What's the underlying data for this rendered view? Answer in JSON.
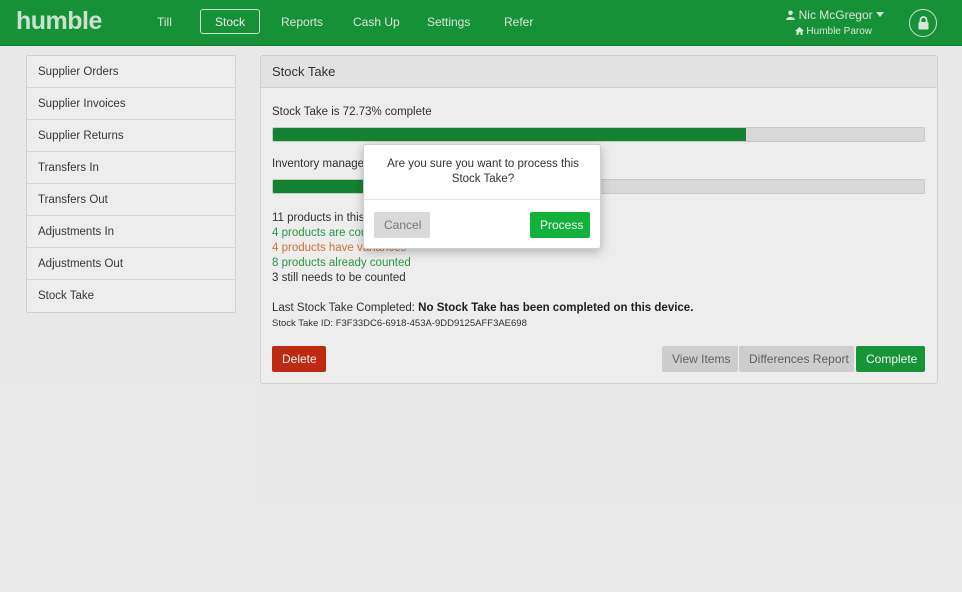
{
  "app": {
    "logo": "humble",
    "nav": [
      "Till",
      "Stock",
      "Reports",
      "Cash Up",
      "Settings",
      "Refer"
    ],
    "active_nav": "Stock",
    "user_name": "Nic McGregor",
    "store_name": "Humble Parow",
    "accent_color": "#19993a"
  },
  "sidebar": {
    "items": [
      "Supplier Orders",
      "Supplier Invoices",
      "Supplier Returns",
      "Transfers In",
      "Transfers Out",
      "Adjustments In",
      "Adjustments Out",
      "Stock Take"
    ]
  },
  "panel": {
    "title": "Stock Take",
    "progress_text": "Stock Take is 72.73% complete",
    "progress_value": 72.73,
    "inventory_label": "Inventory manager",
    "inventory_progress_value": 14,
    "stats": {
      "products": "11 products in this",
      "counted": "4 products are cou",
      "variances": "4 products have variances",
      "already_counted": "8 products already counted",
      "needs_count": "3 still needs to be counted"
    },
    "last_label": "Last Stock Take Completed: ",
    "last_value": "No Stock Take has been completed on this device.",
    "stock_take_id": "Stock Take ID: F3F33DC6-6918-453A-9DD9125AFF3AE698",
    "buttons": {
      "delete": "Delete",
      "view_items": "View Items",
      "differences": "Differences Report",
      "complete": "Complete"
    }
  },
  "modal": {
    "message": "Are you sure you want to process this Stock Take?",
    "cancel": "Cancel",
    "process": "Process"
  }
}
